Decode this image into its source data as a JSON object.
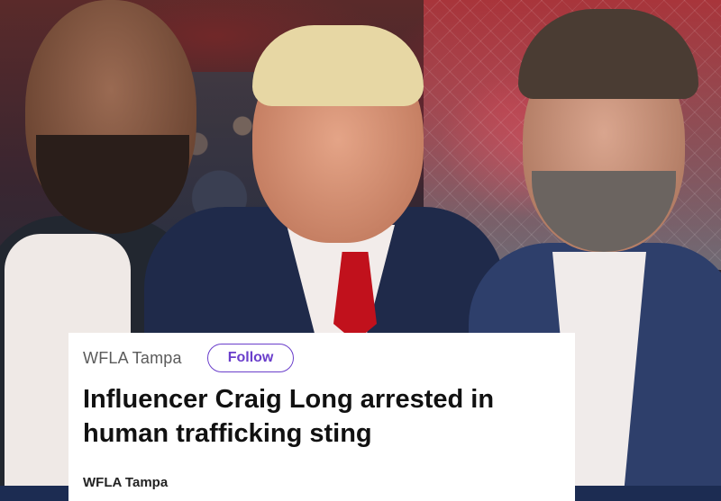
{
  "post": {
    "source_name": "WFLA Tampa",
    "follow_label": "Follow",
    "headline": "Influencer Craig Long arrested in human trafficking sting",
    "byline": "WFLA Tampa"
  },
  "colors": {
    "follow_accent": "#6a3ecb",
    "card_bg": "#ffffff",
    "headline_text": "#111111",
    "tie_red": "#c1111c",
    "bottom_band": "#1c2c52"
  },
  "icons": []
}
